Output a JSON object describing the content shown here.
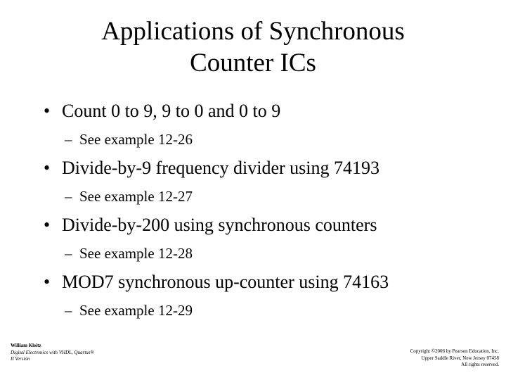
{
  "slide": {
    "title": {
      "line1": "Applications of Synchronous",
      "line2": "Counter ICs"
    },
    "bullet_marker": "•",
    "subbullet_marker": "–",
    "bullets": [
      {
        "text": "Count 0 to 9, 9 to 0 and 0 to 9",
        "sub": "See example 12-26"
      },
      {
        "text": "Divide-by-9 frequency divider using 74193",
        "sub": "See example 12-27"
      },
      {
        "text": "Divide-by-200 using synchronous counters",
        "sub": "See example 12-28"
      },
      {
        "text": "MOD7 synchronous up-counter using 74163",
        "sub": "See example 12-29"
      }
    ],
    "footer_left": {
      "author": "William Kleitz",
      "book": "Digital Electronics with VHDL, Quartus®",
      "version": "II Version"
    },
    "footer_right": {
      "line1": "Copyright ©2006 by Pearson Education, Inc.",
      "line2": "Upper Saddle River, New Jersey 07458",
      "line3": "All rights reserved."
    },
    "colors": {
      "background": "#ffffff",
      "text": "#000000"
    }
  }
}
